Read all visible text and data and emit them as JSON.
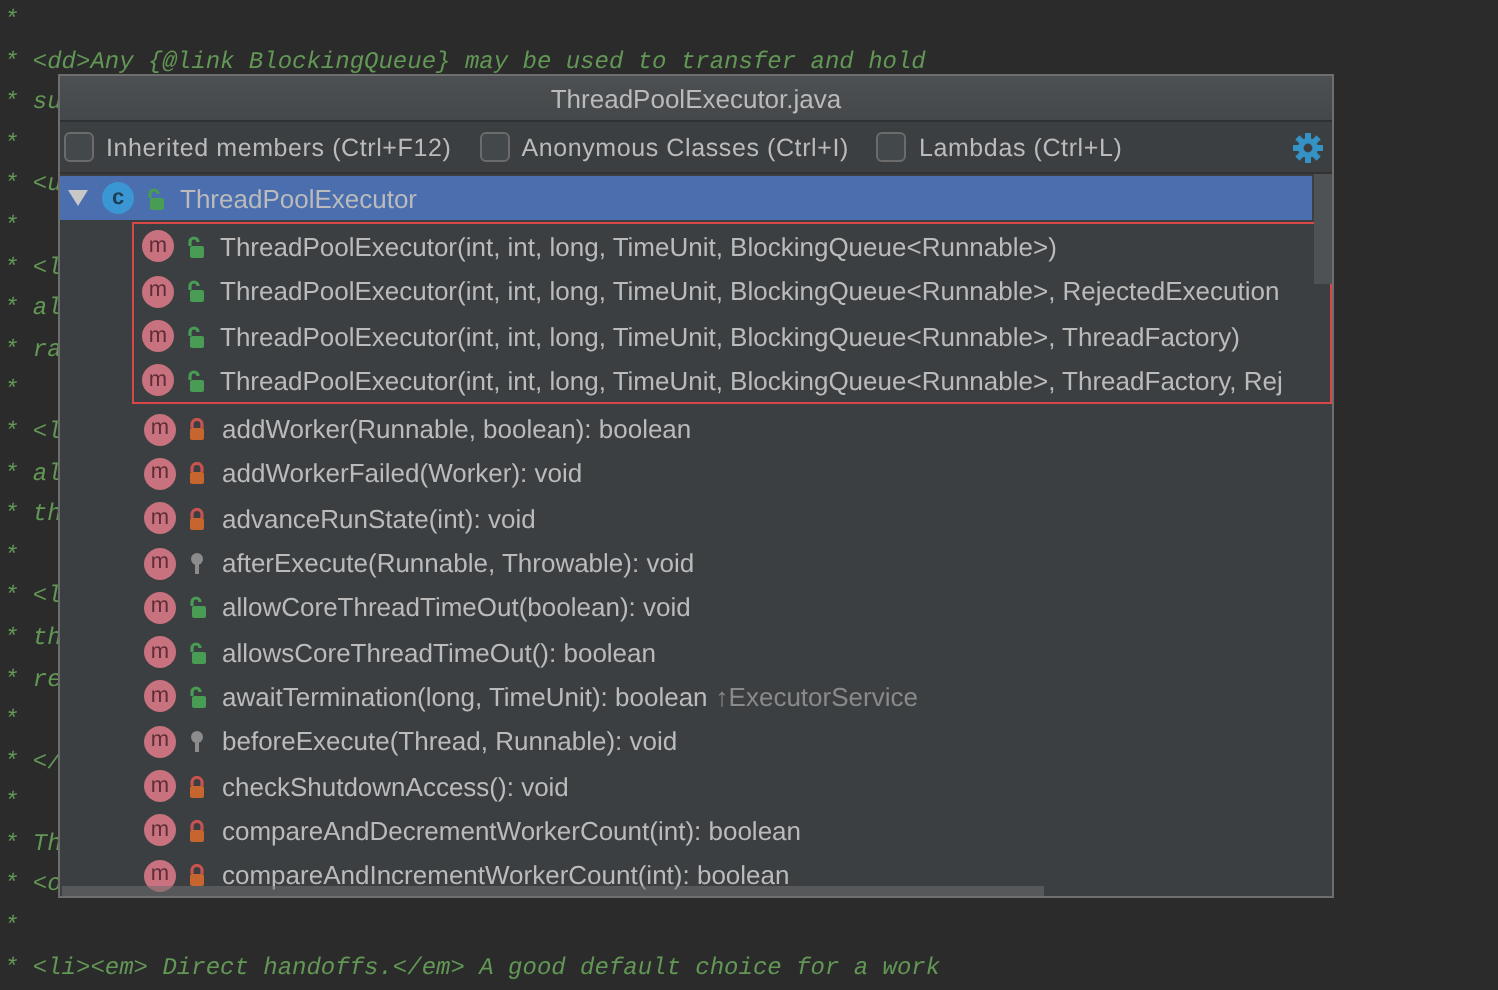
{
  "editor_lines": [
    {
      "text": "*"
    },
    {
      "text": "* <dd>Any {@link BlockingQueue} may be used to transfer and hold"
    },
    {
      "text": "* su"
    },
    {
      "text": "*"
    },
    {
      "text": "* <u"
    },
    {
      "text": "*"
    },
    {
      "text": "* <l"
    },
    {
      "text": "* al"
    },
    {
      "text": "* ra"
    },
    {
      "text": "*"
    },
    {
      "text": "* <l"
    },
    {
      "text": "* al"
    },
    {
      "text": "* th"
    },
    {
      "text": "*"
    },
    {
      "text": "* <l"
    },
    {
      "text": "* th"
    },
    {
      "text": "* re"
    },
    {
      "text": "*"
    },
    {
      "text": "* </"
    },
    {
      "text": "*"
    },
    {
      "text": "* Th"
    },
    {
      "text": "* <o"
    },
    {
      "text": "*"
    },
    {
      "text": "* <li><em> Direct handoffs.</em> A good default choice for a work"
    }
  ],
  "window": {
    "title": "ThreadPoolExecutor.java"
  },
  "filters": [
    {
      "label": "Inherited members (Ctrl+F12)",
      "checked": false
    },
    {
      "label": "Anonymous Classes (Ctrl+I)",
      "checked": false
    },
    {
      "label": "Lambdas (Ctrl+L)",
      "checked": false
    }
  ],
  "tree": {
    "label": "ThreadPoolExecutor",
    "icon_letter": "c",
    "kind": "public",
    "expanded": true,
    "selected": true,
    "children": [
      {
        "label": "ThreadPoolExecutor(int, int, long, TimeUnit, BlockingQueue<Runnable>)",
        "icon_letter": "m",
        "kind": "public",
        "highlighted": true,
        "selected": false
      },
      {
        "label": "ThreadPoolExecutor(int, int, long, TimeUnit, BlockingQueue<Runnable>, RejectedExecution",
        "icon_letter": "m",
        "kind": "public",
        "highlighted": true,
        "selected": false
      },
      {
        "label": "ThreadPoolExecutor(int, int, long, TimeUnit, BlockingQueue<Runnable>, ThreadFactory)",
        "icon_letter": "m",
        "kind": "public",
        "highlighted": true,
        "selected": false
      },
      {
        "label": "ThreadPoolExecutor(int, int, long, TimeUnit, BlockingQueue<Runnable>, ThreadFactory, Rej",
        "icon_letter": "m",
        "kind": "public",
        "highlighted": true,
        "selected": false
      },
      {
        "label": "addWorker(Runnable, boolean): boolean",
        "icon_letter": "m",
        "kind": "private",
        "highlighted": false,
        "selected": false
      },
      {
        "label": "addWorkerFailed(Worker): void",
        "icon_letter": "m",
        "kind": "private",
        "highlighted": false,
        "selected": false
      },
      {
        "label": "advanceRunState(int): void",
        "icon_letter": "m",
        "kind": "private",
        "highlighted": false,
        "selected": false
      },
      {
        "label": "afterExecute(Runnable, Throwable): void",
        "icon_letter": "m",
        "kind": "protected",
        "highlighted": false,
        "selected": false
      },
      {
        "label": "allowCoreThreadTimeOut(boolean): void",
        "icon_letter": "m",
        "kind": "public",
        "highlighted": false,
        "selected": false
      },
      {
        "label": "allowsCoreThreadTimeOut(): boolean",
        "icon_letter": "m",
        "kind": "public",
        "highlighted": false,
        "selected": false
      },
      {
        "label": "awaitTermination(long, TimeUnit): boolean",
        "inherited_from": "↑ExecutorService",
        "icon_letter": "m",
        "kind": "public",
        "highlighted": false,
        "selected": false
      },
      {
        "label": "beforeExecute(Thread, Runnable): void",
        "icon_letter": "m",
        "kind": "protected",
        "highlighted": false,
        "selected": false
      },
      {
        "label": "checkShutdownAccess(): void",
        "icon_letter": "m",
        "kind": "private",
        "highlighted": false,
        "selected": false
      },
      {
        "label": "compareAndDecrementWorkerCount(int): boolean",
        "icon_letter": "m",
        "kind": "private",
        "highlighted": false,
        "selected": false
      },
      {
        "label": "compareAndIncrementWorkerCount(int): boolean",
        "icon_letter": "m",
        "kind": "private",
        "highlighted": false,
        "selected": false
      }
    ]
  }
}
